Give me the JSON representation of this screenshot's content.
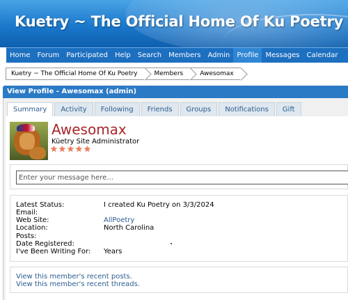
{
  "site": {
    "title": "Kuetry ~ The Official Home Of Ku Poetry"
  },
  "nav": {
    "items": [
      "Home",
      "Forum",
      "Participated",
      "Help",
      "Search",
      "Members",
      "Admin",
      "Profile",
      "Messages",
      "Calendar"
    ],
    "active": "Profile"
  },
  "breadcrumb": [
    "Kuetry ~ The Official Home Of Ku Poetry",
    "Members",
    "Awesomax"
  ],
  "profile": {
    "header": "View Profile - Awesomax (admin)",
    "tabs": [
      "Summary",
      "Activity",
      "Following",
      "Friends",
      "Groups",
      "Notifications",
      "Gift"
    ],
    "active_tab": "Summary",
    "username": "Awesomax",
    "user_title": "Küetry Site Administrator",
    "star_rating": 5,
    "message_placeholder": "Enter your message here...",
    "fields": {
      "status_label": "Latest Status:",
      "status_value": "I created Ku Poetry on 3/3/2024",
      "email_label": "Email:",
      "website_label": "Web Site:",
      "website_value": "AllPoetry",
      "location_label": "Location:",
      "location_value": "North Carolina",
      "posts_label": "Posts:",
      "registered_label": "Date Registered:",
      "writing_label": "I've Been Writing For:",
      "writing_value": "Years"
    },
    "links": {
      "recent_posts": "View this member's recent posts.",
      "recent_threads": "View this member's recent threads."
    }
  },
  "colors": {
    "banner": "#1a78cc",
    "nav": "#1d6fbf",
    "header": "#2b7ac6",
    "username": "#a9262a",
    "link": "#2b5d8f"
  }
}
